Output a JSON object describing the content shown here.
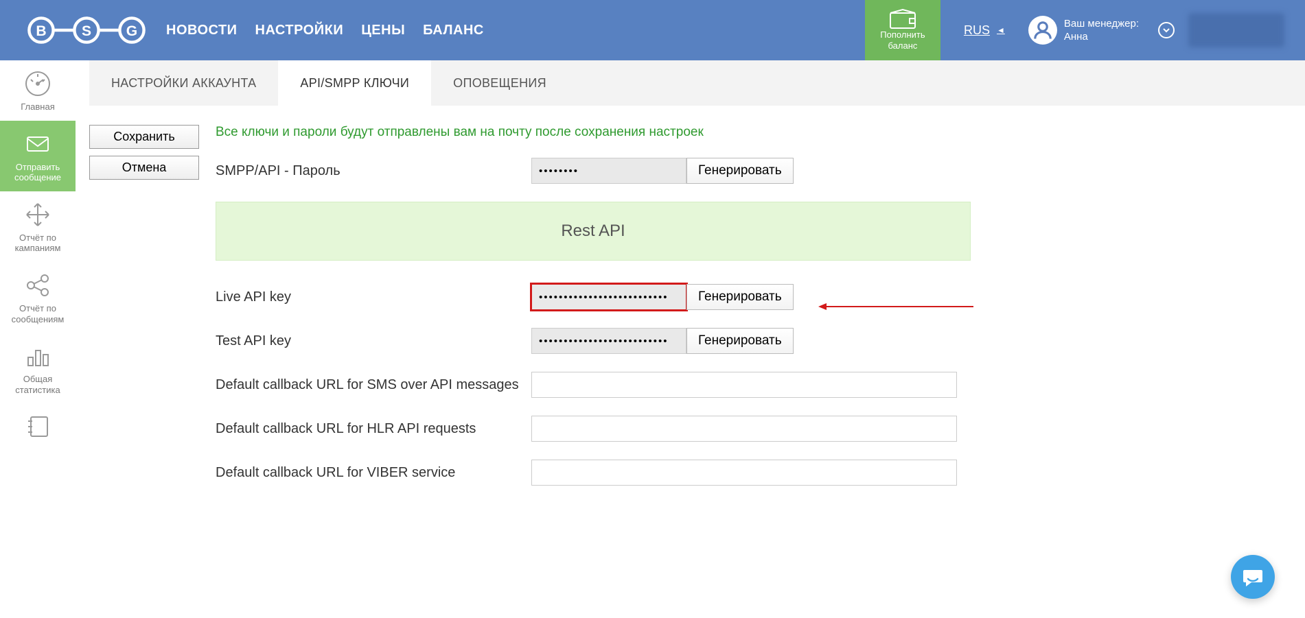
{
  "header": {
    "nav": {
      "news": "НОВОСТИ",
      "settings": "НАСТРОЙКИ",
      "prices": "ЦЕНЫ",
      "balance": "БАЛАНС"
    },
    "topup": {
      "line1": "Пополнить",
      "line2": "баланс"
    },
    "lang": "RUS",
    "manager_caption": "Ваш менеджер:",
    "manager_name": "Анна"
  },
  "sidebar": {
    "home": "Главная",
    "send": "Отправить сообщение",
    "campaign": "Отчёт по кампаниям",
    "messages": "Отчёт по сообщениям",
    "stats": "Общая статистика"
  },
  "tabs": {
    "account": "НАСТРОЙКИ АККАУНТА",
    "api": "API/SMPP КЛЮЧИ",
    "notif": "ОПОВЕЩЕНИЯ"
  },
  "actions": {
    "save": "Сохранить",
    "cancel": "Отмена"
  },
  "notice": "Все ключи и пароли будут отправлены вам на почту после сохранения настроек",
  "labels": {
    "smpp": "SMPP/API - Пароль",
    "restapi": "Rest API",
    "live": "Live API key",
    "test": "Test API key",
    "cb_sms": "Default callback URL for SMS over API messages",
    "cb_hlr": "Default callback URL for HLR API requests",
    "cb_viber": "Default callback URL for VIBER service",
    "gen": "Генерировать"
  },
  "values": {
    "smpp": "••••••••",
    "live": "••••••••••••••••••••••••••",
    "test": "••••••••••••••••••••••••••",
    "cb_sms": "",
    "cb_hlr": "",
    "cb_viber": ""
  }
}
